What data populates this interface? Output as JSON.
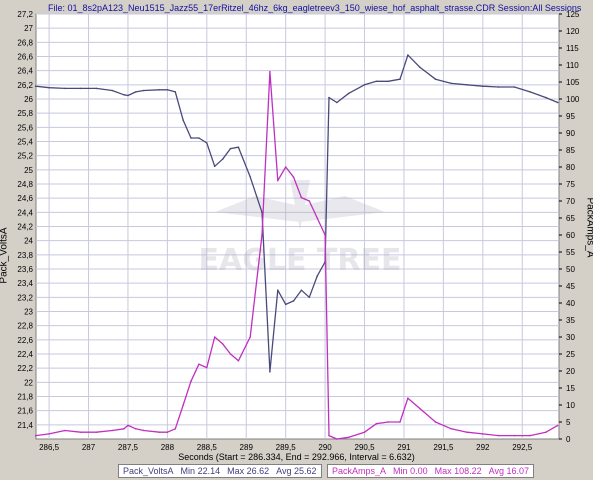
{
  "chart_data": {
    "type": "line",
    "title": "File: 01_8s2pA123_Neu1515_Jazz55_17erRitzel_46hz_6kg_eagletreev3_150_wiese_hof_asphalt_strasse.CDR   Session:All Sessions",
    "xlabel": "Seconds (Start = 286.334,  End = 292.966,  Interval = 6.632)",
    "ylabel_left": "Pack_VoltsA",
    "ylabel_right": "PackAmps_A",
    "xlim": [
      286.334,
      292.966
    ],
    "ylim_left": [
      21.2,
      27.2
    ],
    "ylim_right": [
      0,
      125
    ],
    "x_ticks": [
      "286,5",
      "287",
      "287,5",
      "288",
      "288,5",
      "289",
      "289,5",
      "290",
      "290,5",
      "291",
      "291,5",
      "292",
      "292,5"
    ],
    "y_left_ticks": [
      "27,2",
      "27",
      "26,8",
      "26,6",
      "26,4",
      "26,2",
      "26",
      "25,8",
      "25,6",
      "25,4",
      "25,2",
      "25",
      "24,8",
      "24,6",
      "24,4",
      "24,2",
      "24",
      "23,8",
      "23,6",
      "23,4",
      "23,2",
      "23",
      "22,8",
      "22,6",
      "22,4",
      "22,2",
      "22",
      "21,8",
      "21,6",
      "21,4"
    ],
    "y_right_ticks": [
      "125",
      "120",
      "115",
      "110",
      "105",
      "100",
      "95",
      "90",
      "85",
      "80",
      "75",
      "70",
      "65",
      "60",
      "55",
      "50",
      "45",
      "40",
      "35",
      "30",
      "25",
      "20",
      "15",
      "10",
      "5",
      "0"
    ],
    "grid": true,
    "watermark": "EAGLE TREE",
    "series": [
      {
        "name": "Pack_VoltsA",
        "axis": "left",
        "color": "#4a4a7a",
        "x": [
          286.33,
          286.5,
          286.7,
          286.9,
          287.1,
          287.3,
          287.45,
          287.5,
          287.6,
          287.7,
          287.9,
          288.0,
          288.1,
          288.2,
          288.3,
          288.4,
          288.5,
          288.6,
          288.7,
          288.8,
          288.9,
          289.05,
          289.2,
          289.3,
          289.4,
          289.5,
          289.6,
          289.7,
          289.8,
          289.9,
          290.0,
          290.05,
          290.15,
          290.3,
          290.5,
          290.65,
          290.8,
          290.95,
          291.05,
          291.2,
          291.4,
          291.6,
          291.8,
          292.0,
          292.2,
          292.4,
          292.6,
          292.8,
          292.95
        ],
        "y": [
          26.18,
          26.16,
          26.15,
          26.15,
          26.15,
          26.12,
          26.06,
          26.05,
          26.1,
          26.12,
          26.13,
          26.13,
          26.1,
          25.7,
          25.45,
          25.45,
          25.38,
          25.05,
          25.15,
          25.3,
          25.32,
          24.9,
          24.4,
          22.15,
          23.3,
          23.1,
          23.15,
          23.3,
          23.2,
          23.5,
          23.7,
          26.02,
          25.95,
          26.08,
          26.2,
          26.25,
          26.25,
          26.28,
          26.62,
          26.45,
          26.28,
          26.22,
          26.2,
          26.18,
          26.17,
          26.17,
          26.1,
          26.02,
          25.95
        ]
      },
      {
        "name": "PackAmps_A",
        "axis": "right",
        "color": "#c030c0",
        "x": [
          286.33,
          286.5,
          286.7,
          286.9,
          287.1,
          287.3,
          287.45,
          287.5,
          287.6,
          287.7,
          287.9,
          288.0,
          288.1,
          288.2,
          288.3,
          288.4,
          288.5,
          288.6,
          288.7,
          288.8,
          288.9,
          289.05,
          289.2,
          289.3,
          289.4,
          289.5,
          289.6,
          289.7,
          289.8,
          289.9,
          290.0,
          290.05,
          290.15,
          290.3,
          290.5,
          290.65,
          290.8,
          290.95,
          291.05,
          291.2,
          291.4,
          291.6,
          291.8,
          292.0,
          292.2,
          292.4,
          292.6,
          292.8,
          292.95
        ],
        "y": [
          1,
          1.5,
          2.5,
          2,
          2,
          2.5,
          3,
          4,
          3,
          2.5,
          2,
          2,
          3,
          10,
          17,
          22,
          21,
          30,
          28,
          25,
          23,
          30,
          60,
          108,
          76,
          80,
          77,
          71,
          70,
          65,
          60,
          1,
          0,
          0.5,
          2,
          4.5,
          5,
          5,
          12,
          9,
          5,
          3,
          2,
          1.5,
          1,
          1,
          1,
          2,
          4
        ]
      }
    ],
    "legend": [
      {
        "name": "Pack_VoltsA",
        "min_label": "Min",
        "min": "22.14",
        "max_label": "Max",
        "max": "26.62",
        "avg_label": "Avg",
        "avg": "25.62"
      },
      {
        "name": "PackAmps_A",
        "min_label": "Min",
        "min": "0.00",
        "max_label": "Max",
        "max": "108.22",
        "avg_label": "Avg",
        "avg": "16.07"
      }
    ]
  }
}
